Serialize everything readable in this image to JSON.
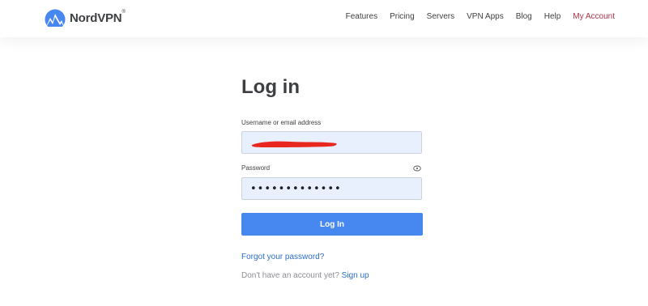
{
  "header": {
    "brand": "NordVPN",
    "trademark": "®",
    "nav": [
      {
        "label": "Features"
      },
      {
        "label": "Pricing"
      },
      {
        "label": "Servers"
      },
      {
        "label": "VPN Apps"
      },
      {
        "label": "Blog"
      },
      {
        "label": "Help"
      },
      {
        "label": "My Account"
      }
    ]
  },
  "login": {
    "title": "Log in",
    "username_label": "Username or email address",
    "username_value": "",
    "password_label": "Password",
    "password_value": "•••••••••••••",
    "submit_label": "Log In",
    "forgot_link": "Forgot your password?",
    "no_account_text": "Don't have an account yet?",
    "signup_link": "Sign up"
  },
  "colors": {
    "brand_blue": "#4687f0",
    "link_blue": "#2b6fc8",
    "account_red": "#b03047",
    "field_bg": "#e8f0fe",
    "redaction": "#e8281e"
  },
  "icons": [
    "nordvpn-logo-icon",
    "eye-icon"
  ]
}
